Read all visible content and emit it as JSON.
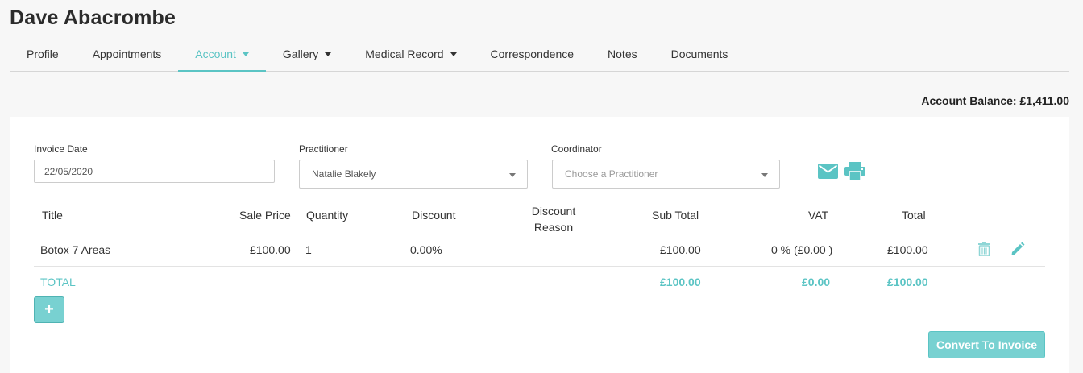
{
  "page_title": "Dave Abacrombe",
  "tabs": [
    {
      "label": "Profile",
      "dropdown": false,
      "active": false
    },
    {
      "label": "Appointments",
      "dropdown": false,
      "active": false
    },
    {
      "label": "Account",
      "dropdown": true,
      "active": true
    },
    {
      "label": "Gallery",
      "dropdown": true,
      "active": false
    },
    {
      "label": "Medical Record",
      "dropdown": true,
      "active": false
    },
    {
      "label": "Correspondence",
      "dropdown": false,
      "active": false
    },
    {
      "label": "Notes",
      "dropdown": false,
      "active": false
    },
    {
      "label": "Documents",
      "dropdown": false,
      "active": false
    }
  ],
  "account_balance": "Account Balance: £1,411.00",
  "form": {
    "invoice_date_label": "Invoice Date",
    "invoice_date_value": "22/05/2020",
    "practitioner_label": "Practitioner",
    "practitioner_value": "Natalie Blakely",
    "coordinator_label": "Coordinator",
    "coordinator_placeholder": "Choose a Practitioner"
  },
  "icons": {
    "email": "envelope-icon",
    "print": "printer-icon",
    "delete": "trash-icon",
    "edit": "pencil-icon",
    "add": "plus-icon"
  },
  "table": {
    "headers": {
      "title": "Title",
      "sale_price": "Sale Price",
      "quantity": "Quantity",
      "discount": "Discount",
      "discount_reason_line1": "Discount",
      "discount_reason_line2": "Reason",
      "sub_total": "Sub Total",
      "vat": "VAT",
      "total": "Total"
    },
    "rows": [
      {
        "title": "Botox 7 Areas",
        "sale_price": "£100.00",
        "quantity": "1",
        "discount": "0.00%",
        "discount_reason": "",
        "sub_total": "£100.00",
        "vat": "0 % (£0.00 )",
        "total": "£100.00"
      }
    ],
    "footer": {
      "label": "TOTAL",
      "sub_total": "£100.00",
      "vat": "£0.00",
      "total": "£100.00"
    }
  },
  "add_button_label": "+",
  "convert_button_label": "Convert To Invoice",
  "colors": {
    "accent": "#5bc4c4",
    "button": "#78d1d1",
    "background": "#f7f7f7"
  }
}
